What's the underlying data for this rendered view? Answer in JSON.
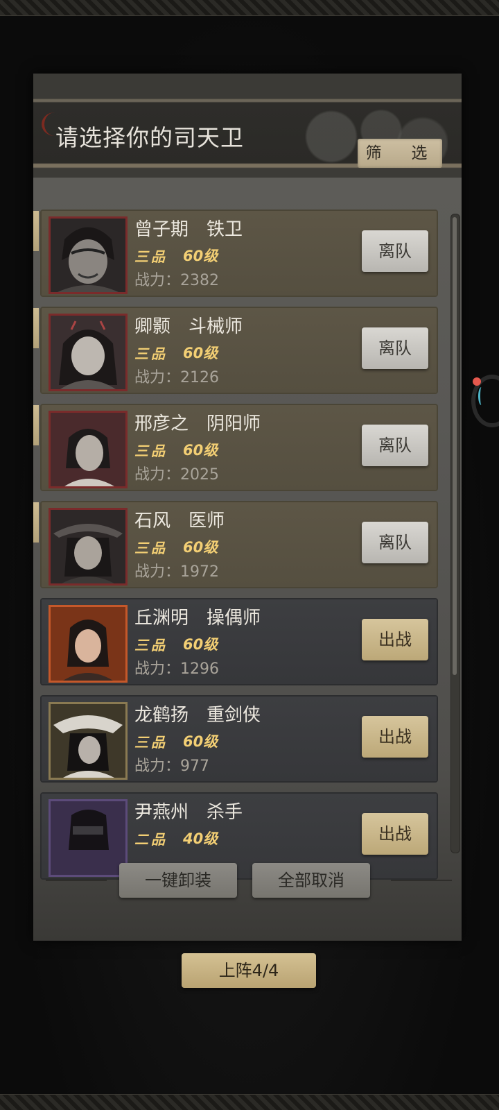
{
  "panel": {
    "title": "请选择你的司天卫",
    "filter_label": "筛　选"
  },
  "heroes": [
    {
      "slot": "1",
      "name": "曾子期　铁卫",
      "grade": "三品",
      "level": "60级",
      "power": "战力：2382",
      "action": "离队",
      "selected": true
    },
    {
      "slot": "2",
      "name": "卿颢　斗械师",
      "grade": "三品",
      "level": "60级",
      "power": "战力：2126",
      "action": "离队",
      "selected": true
    },
    {
      "slot": "3",
      "name": "邢彦之　阴阳师",
      "grade": "三品",
      "level": "60级",
      "power": "战力：2025",
      "action": "离队",
      "selected": true
    },
    {
      "slot": "4",
      "name": "石风　医师",
      "grade": "三品",
      "level": "60级",
      "power": "战力：1972",
      "action": "离队",
      "selected": true
    },
    {
      "slot": "",
      "name": "丘渊明　操偶师",
      "grade": "三品",
      "level": "60级",
      "power": "战力：1296",
      "action": "出战",
      "selected": false
    },
    {
      "slot": "",
      "name": "龙鹤扬　重剑侠",
      "grade": "三品",
      "level": "60级",
      "power": "战力：977",
      "action": "出战",
      "selected": false
    },
    {
      "slot": "",
      "name": "尹燕州　杀手",
      "grade": "二品",
      "level": "40级",
      "power": "",
      "action": "出战",
      "selected": false
    }
  ],
  "bottom": {
    "unequip_all": "一键卸装",
    "cancel_all": "全部取消",
    "deploy_count": "上阵4/4"
  },
  "colors": {
    "selected_row": "#5a5343",
    "unselected_row": "#3a3b3e",
    "grade_text": "#f3cf74",
    "gold_button": "#cbb88a"
  }
}
